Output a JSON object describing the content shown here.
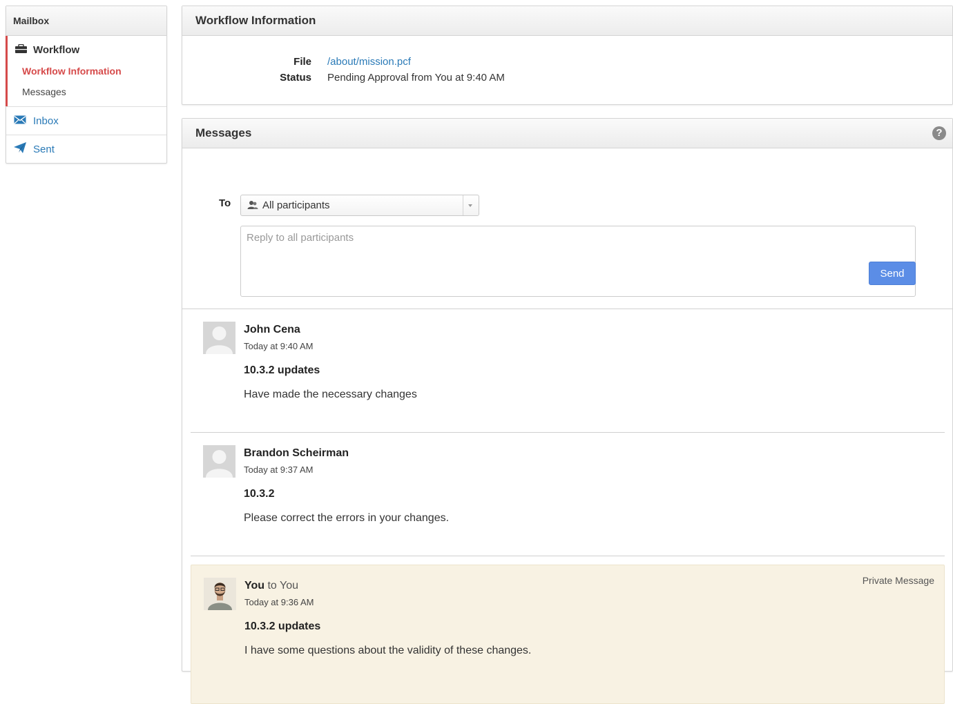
{
  "sidebar": {
    "title": "Mailbox",
    "workflow": {
      "label": "Workflow",
      "items": [
        {
          "label": "Workflow Information"
        },
        {
          "label": "Messages"
        }
      ]
    },
    "links": [
      {
        "label": "Inbox",
        "icon": "envelope-icon"
      },
      {
        "label": "Sent",
        "icon": "paper-plane-icon"
      }
    ]
  },
  "workflow_info": {
    "title": "Workflow Information",
    "file_label": "File",
    "file_value": "/about/mission.pcf",
    "status_label": "Status",
    "status_value": "Pending Approval from You at 9:40 AM"
  },
  "messages_panel": {
    "title": "Messages",
    "to_label": "To",
    "to_selected": "All participants",
    "reply_placeholder": "Reply to all participants",
    "send_label": "Send"
  },
  "messages": [
    {
      "author": "John Cena",
      "time": "Today at 9:40 AM",
      "subject": "10.3.2 updates",
      "body": "Have made the necessary changes",
      "private": false
    },
    {
      "author": "Brandon Scheirman",
      "time": "Today at 9:37 AM",
      "subject": "10.3.2",
      "body": "Please correct the errors in your changes.",
      "private": false
    },
    {
      "author": "You",
      "to_text": "to You",
      "time": "Today at 9:36 AM",
      "subject": "10.3.2 updates",
      "body": "I have some questions about the validity of these changes.",
      "private": true,
      "flag": "Private Message"
    }
  ],
  "colors": {
    "accent_red": "#d64a4a",
    "link_blue": "#2a7ab7",
    "send_button": "#5b8de6",
    "private_bg": "#f8f2e3"
  }
}
